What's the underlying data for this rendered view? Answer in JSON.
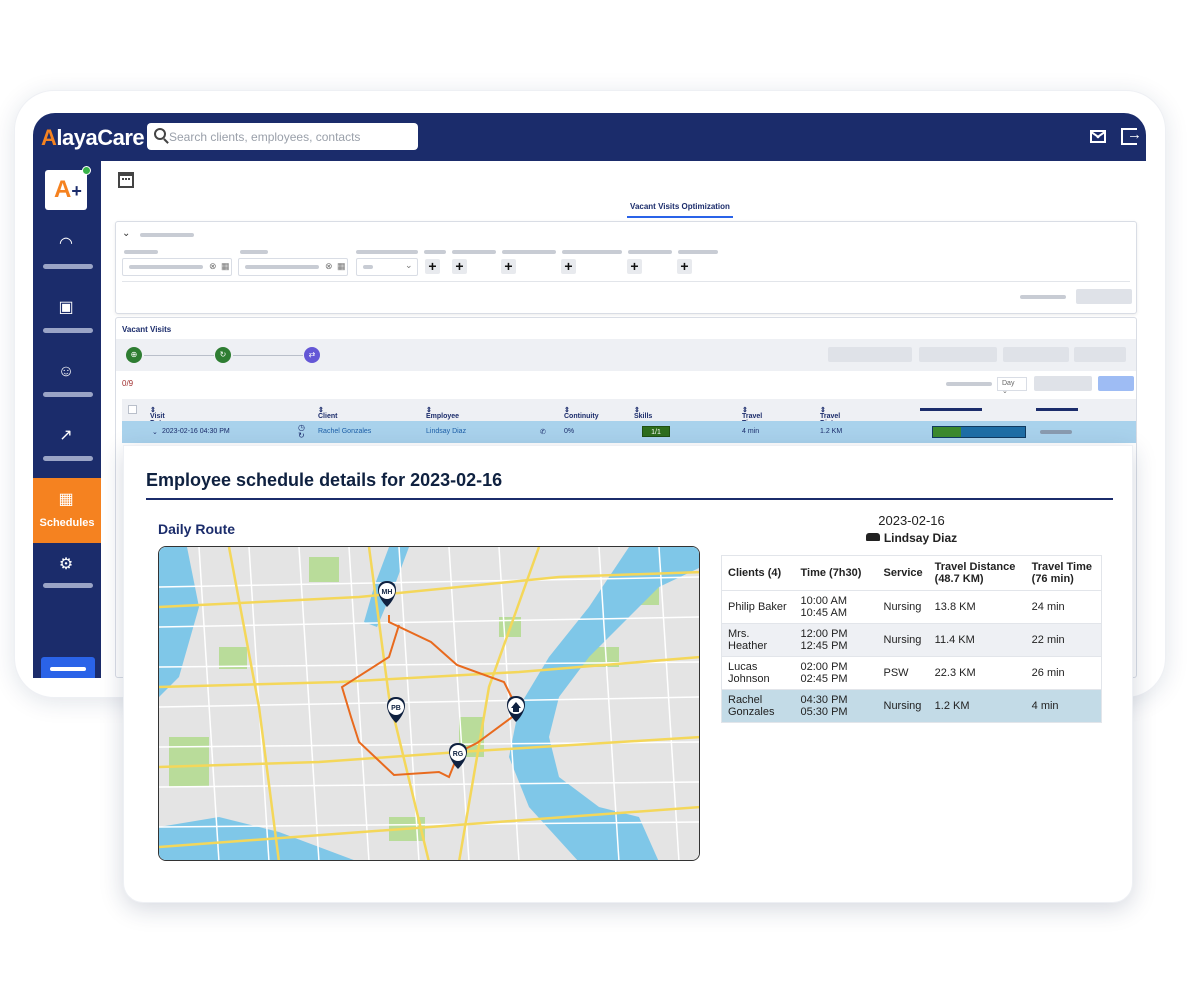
{
  "app": {
    "logo_text": "AlayaCare",
    "logo_initial": "A"
  },
  "search": {
    "placeholder": "Search clients, employees, contacts"
  },
  "sidebar": {
    "active_label": "Schedules"
  },
  "tabs": {
    "active": "Vacant Visits Optimization"
  },
  "vacant": {
    "title": "Vacant Visits",
    "count": "0/9",
    "day_select": "Day",
    "headers": {
      "visit_date": "Visit Date",
      "client": "Client",
      "employee": "Employee",
      "continuity": "Continuity",
      "skills": "Skills",
      "travel_time": "Travel Time",
      "travel_distance": "Travel Distance"
    },
    "row": {
      "visit_date": "2023-02-16 04:30 PM",
      "client": "Rachel Gonzales",
      "employee": "Lindsay Diaz",
      "continuity": "0%",
      "skills": "1/1",
      "travel_time": "4 min",
      "travel_distance": "1.2 KM",
      "score": 0.3
    }
  },
  "details": {
    "title": "Employee schedule details for 2023-02-16",
    "route_title": "Daily Route",
    "date": "2023-02-16",
    "employee": "Lindsay Diaz",
    "headers": {
      "clients": "Clients (4)",
      "time": "Time (7h30)",
      "service": "Service",
      "distance": "Travel Distance (48.7 KM)",
      "travel_time": "Travel Time (76 min)"
    },
    "rows": [
      {
        "client": "Philip Baker",
        "time_start": "10:00 AM",
        "time_end": "10:45 AM",
        "service": "Nursing",
        "distance": "13.8 KM",
        "travel_time": "24 min"
      },
      {
        "client": "Mrs. Heather",
        "time_start": "12:00 PM",
        "time_end": "12:45 PM",
        "service": "Nursing",
        "distance": "11.4 KM",
        "travel_time": "22 min"
      },
      {
        "client": "Lucas Johnson",
        "time_start": "02:00 PM",
        "time_end": "02:45 PM",
        "service": "PSW",
        "distance": "22.3 KM",
        "travel_time": "26 min"
      },
      {
        "client": "Rachel Gonzales",
        "time_start": "04:30 PM",
        "time_end": "05:30 PM",
        "service": "Nursing",
        "distance": "1.2 KM",
        "travel_time": "4 min"
      }
    ],
    "map_pins": {
      "mh": "MH",
      "pb": "PB",
      "rg": "RG"
    }
  },
  "colors": {
    "navy": "#1b2c6b",
    "orange": "#f58220",
    "highlight": "#a9d2ec",
    "route": "#e86a1e",
    "water": "#7fc7e8"
  }
}
